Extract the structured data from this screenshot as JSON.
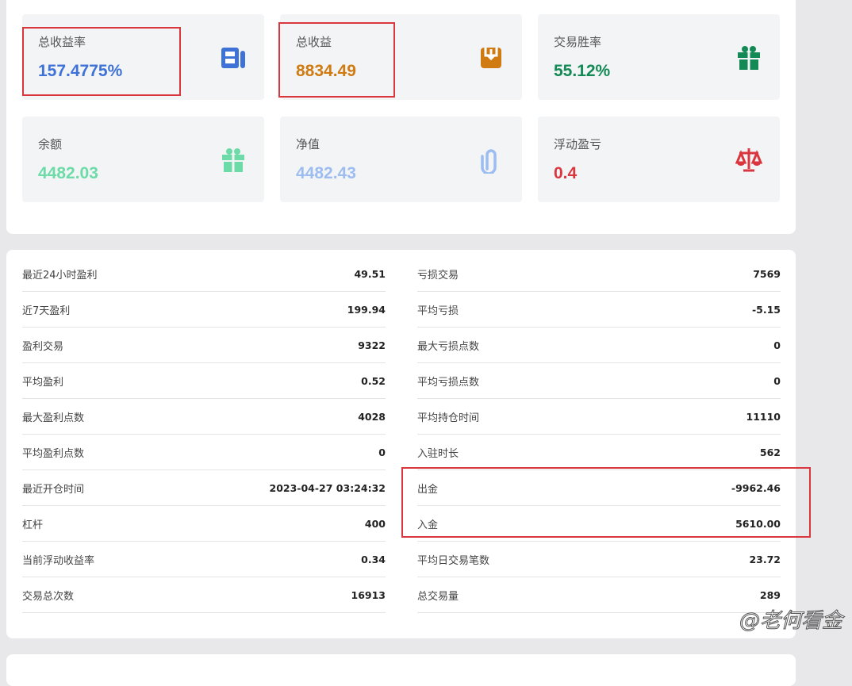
{
  "summary": [
    {
      "label": "总收益率",
      "value": "157.4775%",
      "color": "#3f72d6",
      "icon": "newspaper-icon"
    },
    {
      "label": "总收益",
      "value": "8834.49",
      "color": "#d07a12",
      "icon": "download-tray-icon"
    },
    {
      "label": "交易胜率",
      "value": "55.12%",
      "color": "#138a55",
      "icon": "gift-icon"
    },
    {
      "label": "余额",
      "value": "4482.03",
      "color": "#6ddba8",
      "icon": "gift-icon"
    },
    {
      "label": "净值",
      "value": "4482.43",
      "color": "#9dbdf0",
      "icon": "paperclip-icon"
    },
    {
      "label": "浮动盈亏",
      "value": "0.4",
      "color": "#d9363e",
      "icon": "scale-icon"
    }
  ],
  "stats_left": [
    {
      "label": "最近24小时盈利",
      "value": "49.51"
    },
    {
      "label": "近7天盈利",
      "value": "199.94"
    },
    {
      "label": "盈利交易",
      "value": "9322"
    },
    {
      "label": "平均盈利",
      "value": "0.52"
    },
    {
      "label": "最大盈利点数",
      "value": "4028"
    },
    {
      "label": "平均盈利点数",
      "value": "0"
    },
    {
      "label": "最近开仓时间",
      "value": "2023-04-27 03:24:32"
    },
    {
      "label": "杠杆",
      "value": "400"
    },
    {
      "label": "当前浮动收益率",
      "value": "0.34"
    },
    {
      "label": "交易总次数",
      "value": "16913"
    }
  ],
  "stats_right": [
    {
      "label": "亏损交易",
      "value": "7569"
    },
    {
      "label": "平均亏损",
      "value": "-5.15"
    },
    {
      "label": "最大亏损点数",
      "value": "0"
    },
    {
      "label": "平均亏损点数",
      "value": "0"
    },
    {
      "label": "平均持仓时间",
      "value": "11110"
    },
    {
      "label": "入驻时长",
      "value": "562"
    },
    {
      "label": "出金",
      "value": "-9962.46"
    },
    {
      "label": "入金",
      "value": "5610.00"
    },
    {
      "label": "平均日交易笔数",
      "value": "23.72"
    },
    {
      "label": "总交易量",
      "value": "289"
    }
  ],
  "watermark": "@老何看金"
}
